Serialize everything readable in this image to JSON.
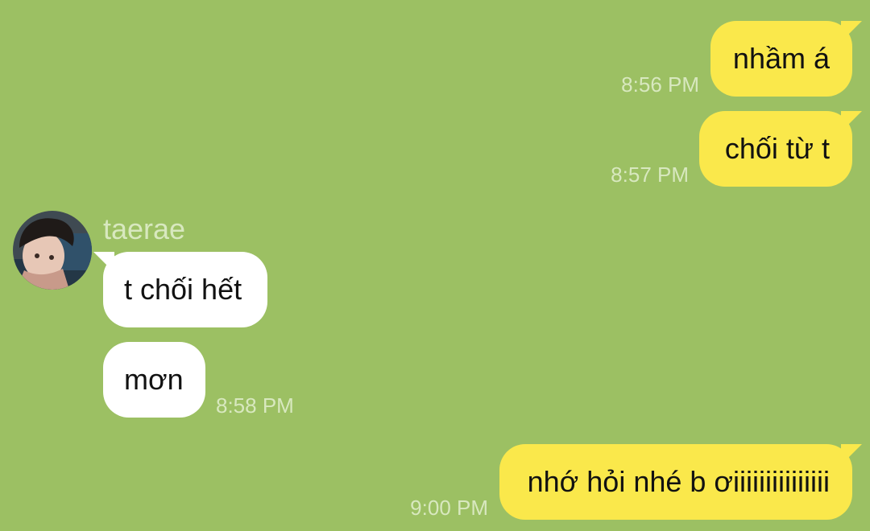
{
  "contact": {
    "name": "taerae"
  },
  "messages": [
    {
      "direction": "outgoing",
      "text": "nhầm á",
      "time": "8:56 PM"
    },
    {
      "direction": "outgoing",
      "text": "chối từ t",
      "time": "8:57 PM"
    },
    {
      "direction": "incoming",
      "text": "t chối hết",
      "time": ""
    },
    {
      "direction": "incoming",
      "text": "mơn",
      "time": "8:58 PM"
    },
    {
      "direction": "outgoing",
      "text": "nhớ hỏi nhé b ơiiiiiiiiiiiiiii",
      "time": "9:00 PM"
    }
  ],
  "colors": {
    "background": "#9cc063",
    "outgoing_bubble": "#fae84b",
    "incoming_bubble": "#ffffff",
    "timestamp": "#d8e8bf"
  }
}
